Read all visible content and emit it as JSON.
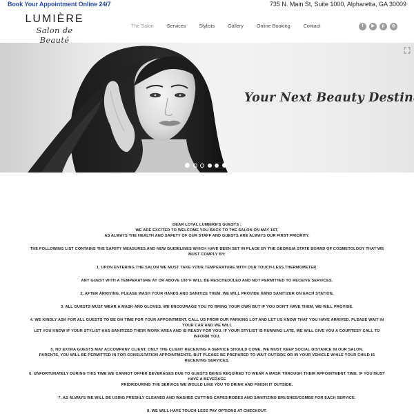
{
  "topbar": {
    "book_link": "Book Your Appointment Online 24/7",
    "address": "735 N. Main St, Suite 1000, Alpharetta, GA 30009"
  },
  "logo": {
    "brand": "LUMIÈRE",
    "script": "Salon de Beauté"
  },
  "nav": {
    "items": [
      "The Salon",
      "Services",
      "Stylists",
      "Gallery",
      "Online Booking",
      "Contact"
    ]
  },
  "social": {
    "icons": [
      "facebook-icon",
      "youtube-icon",
      "pinterest-icon",
      "instagram-icon"
    ],
    "glyphs": [
      "f",
      "▶",
      "p",
      "◎"
    ]
  },
  "hero": {
    "tagline": "Your Next Beauty Destination",
    "slides_count": 6,
    "active_slide": 1
  },
  "notice": {
    "greeting": "Dear Loyal Lumiere's Guests :",
    "welcome": "We are excited to welcome you back to the salon on May 1st.",
    "priority": "As always the health and safety of our staff and guests are always our first priority.",
    "intro": "The following list contains the safety measures and new guidelines which have been set in place by the Georgia State Board of Cosmetology that we must comply by:",
    "item1": "1. Upon entering the salon we must take your temperature with our touch-less thermometer.",
    "item1b": "Any guest with a temperature at or above 100°F will be rescheduled and not permitted to receive services.",
    "item2": "2. After arriving, please wash your hands and sanitize them. We will provide hand sanitizer on each station.",
    "item3": "3. All guests must wear a mask and gloves. We encourage you to bring your own but if you don't have them, we will provide.",
    "item4a": "4. We kindly ask for all guests to be on time for your appointment. Call us from our parking lot and let us know that you have arrived. Please wait in your car and  we will",
    "item4b": "let you know if your stylist has sanitized their work area and is ready for you. If your stylist is running late, we will give you a courtesy call to inform you.",
    "item5a": "5. No extra guests may accompany client, only the client receiving a service should come. We must keep social distance in our salon.",
    "item5b": "Parents, you will be permitted in for consultation appointments, but please be prepared to wait outside or in your vehicle while your child is receiving services.",
    "item6a": "6. Unfortunately during this time we cannot offer beverages due to guests being required to wear a mask through their appointment time.  If you must have a beverage",
    "item6b": "prior/during the service we would like you to drink and finish it outside.",
    "item7": "7. As always we will be using freshly cleaned and washed cutting capes/robes and sanitizing brushes/combs for each service.",
    "item8": "8. We will have touch-less pay options at checkout."
  },
  "colors": {
    "link_blue": "#2a49b8",
    "social_gray": "#9d9d9d",
    "text_dark": "#222222"
  }
}
